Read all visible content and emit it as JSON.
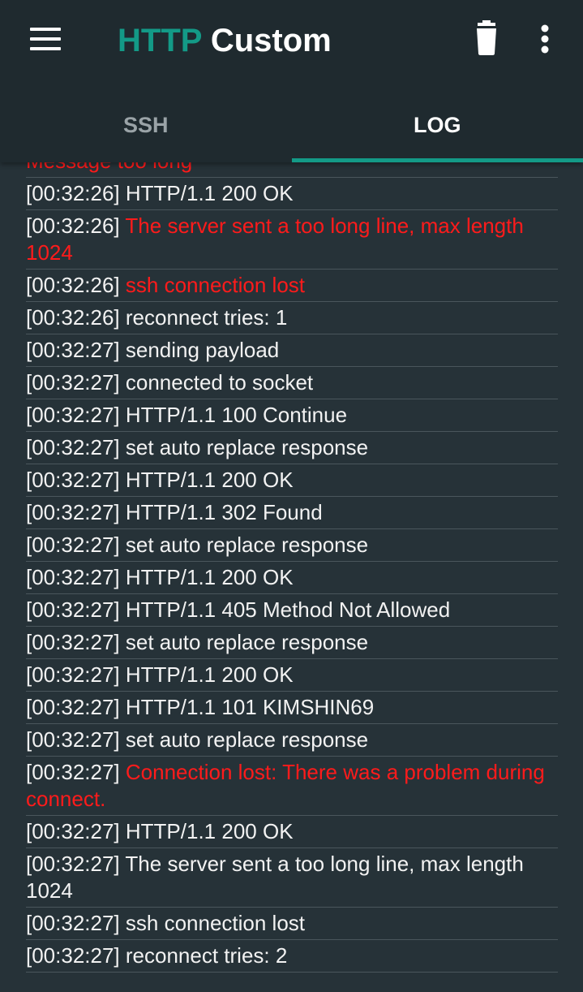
{
  "appbar": {
    "title_part1": "HTTP",
    "title_part2": "Custom",
    "menu_icon": "hamburger-menu-icon",
    "trash_icon": "trash-icon",
    "more_icon": "more-vert-icon"
  },
  "tabs": [
    {
      "label": "SSH",
      "active": false
    },
    {
      "label": "LOG",
      "active": true
    }
  ],
  "colors": {
    "accent": "#139a87",
    "error": "#ff1b1b",
    "background": "#263238",
    "appbar": "#1f2a2f"
  },
  "log": [
    {
      "time": "",
      "message": "Message too long",
      "error": true
    },
    {
      "time": "[00:32:26]",
      "message": "HTTP/1.1 200 OK",
      "error": false
    },
    {
      "time": "[00:32:26]",
      "message": "The server sent a too long line, max length 1024",
      "error": true
    },
    {
      "time": "[00:32:26]",
      "message": "ssh connection lost",
      "error": true
    },
    {
      "time": "[00:32:26]",
      "message": "reconnect tries: 1",
      "error": false
    },
    {
      "time": "[00:32:27]",
      "message": "sending payload",
      "error": false
    },
    {
      "time": "[00:32:27]",
      "message": "connected to socket",
      "error": false
    },
    {
      "time": "[00:32:27]",
      "message": "HTTP/1.1 100 Continue",
      "error": false
    },
    {
      "time": "[00:32:27]",
      "message": "set auto replace response",
      "error": false
    },
    {
      "time": "[00:32:27]",
      "message": "HTTP/1.1 200 OK",
      "error": false
    },
    {
      "time": "[00:32:27]",
      "message": "HTTP/1.1 302 Found",
      "error": false
    },
    {
      "time": "[00:32:27]",
      "message": "set auto replace response",
      "error": false
    },
    {
      "time": "[00:32:27]",
      "message": "HTTP/1.1 200 OK",
      "error": false
    },
    {
      "time": "[00:32:27]",
      "message": "HTTP/1.1 405 Method Not Allowed",
      "error": false
    },
    {
      "time": "[00:32:27]",
      "message": "set auto replace response",
      "error": false
    },
    {
      "time": "[00:32:27]",
      "message": "HTTP/1.1 200 OK",
      "error": false
    },
    {
      "time": "[00:32:27]",
      "message": "HTTP/1.1 101 KIMSHIN69",
      "error": false
    },
    {
      "time": "[00:32:27]",
      "message": "set auto replace response",
      "error": false
    },
    {
      "time": "[00:32:27]",
      "message": "Connection lost: There was a problem during connect.",
      "error": true
    },
    {
      "time": "[00:32:27]",
      "message": "HTTP/1.1 200 OK",
      "error": false
    },
    {
      "time": "[00:32:27]",
      "message": "The server sent a too long line, max length 1024",
      "error": false
    },
    {
      "time": "[00:32:27]",
      "message": "ssh connection lost",
      "error": false
    },
    {
      "time": "[00:32:27]",
      "message": "reconnect tries: 2",
      "error": false
    }
  ]
}
